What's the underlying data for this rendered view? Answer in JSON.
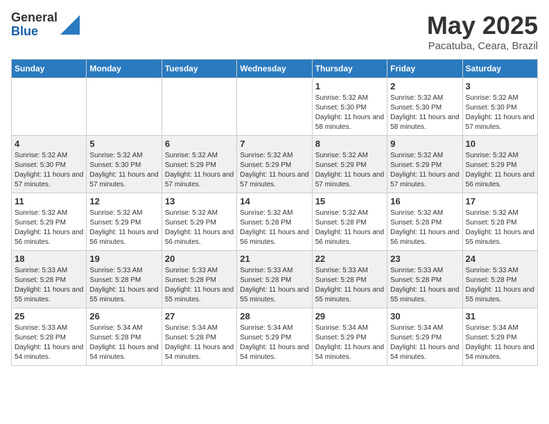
{
  "logo": {
    "general": "General",
    "blue": "Blue"
  },
  "title": "May 2025",
  "location": "Pacatuba, Ceara, Brazil",
  "weekdays": [
    "Sunday",
    "Monday",
    "Tuesday",
    "Wednesday",
    "Thursday",
    "Friday",
    "Saturday"
  ],
  "weeks": [
    [
      {
        "day": "",
        "info": ""
      },
      {
        "day": "",
        "info": ""
      },
      {
        "day": "",
        "info": ""
      },
      {
        "day": "",
        "info": ""
      },
      {
        "day": "1",
        "info": "Sunrise: 5:32 AM\nSunset: 5:30 PM\nDaylight: 11 hours and 58 minutes."
      },
      {
        "day": "2",
        "info": "Sunrise: 5:32 AM\nSunset: 5:30 PM\nDaylight: 11 hours and 58 minutes."
      },
      {
        "day": "3",
        "info": "Sunrise: 5:32 AM\nSunset: 5:30 PM\nDaylight: 11 hours and 57 minutes."
      }
    ],
    [
      {
        "day": "4",
        "info": "Sunrise: 5:32 AM\nSunset: 5:30 PM\nDaylight: 11 hours and 57 minutes."
      },
      {
        "day": "5",
        "info": "Sunrise: 5:32 AM\nSunset: 5:30 PM\nDaylight: 11 hours and 57 minutes."
      },
      {
        "day": "6",
        "info": "Sunrise: 5:32 AM\nSunset: 5:29 PM\nDaylight: 11 hours and 57 minutes."
      },
      {
        "day": "7",
        "info": "Sunrise: 5:32 AM\nSunset: 5:29 PM\nDaylight: 11 hours and 57 minutes."
      },
      {
        "day": "8",
        "info": "Sunrise: 5:32 AM\nSunset: 5:29 PM\nDaylight: 11 hours and 57 minutes."
      },
      {
        "day": "9",
        "info": "Sunrise: 5:32 AM\nSunset: 5:29 PM\nDaylight: 11 hours and 57 minutes."
      },
      {
        "day": "10",
        "info": "Sunrise: 5:32 AM\nSunset: 5:29 PM\nDaylight: 11 hours and 56 minutes."
      }
    ],
    [
      {
        "day": "11",
        "info": "Sunrise: 5:32 AM\nSunset: 5:29 PM\nDaylight: 11 hours and 56 minutes."
      },
      {
        "day": "12",
        "info": "Sunrise: 5:32 AM\nSunset: 5:29 PM\nDaylight: 11 hours and 56 minutes."
      },
      {
        "day": "13",
        "info": "Sunrise: 5:32 AM\nSunset: 5:29 PM\nDaylight: 11 hours and 56 minutes."
      },
      {
        "day": "14",
        "info": "Sunrise: 5:32 AM\nSunset: 5:28 PM\nDaylight: 11 hours and 56 minutes."
      },
      {
        "day": "15",
        "info": "Sunrise: 5:32 AM\nSunset: 5:28 PM\nDaylight: 11 hours and 56 minutes."
      },
      {
        "day": "16",
        "info": "Sunrise: 5:32 AM\nSunset: 5:28 PM\nDaylight: 11 hours and 56 minutes."
      },
      {
        "day": "17",
        "info": "Sunrise: 5:32 AM\nSunset: 5:28 PM\nDaylight: 11 hours and 55 minutes."
      }
    ],
    [
      {
        "day": "18",
        "info": "Sunrise: 5:33 AM\nSunset: 5:28 PM\nDaylight: 11 hours and 55 minutes."
      },
      {
        "day": "19",
        "info": "Sunrise: 5:33 AM\nSunset: 5:28 PM\nDaylight: 11 hours and 55 minutes."
      },
      {
        "day": "20",
        "info": "Sunrise: 5:33 AM\nSunset: 5:28 PM\nDaylight: 11 hours and 55 minutes."
      },
      {
        "day": "21",
        "info": "Sunrise: 5:33 AM\nSunset: 5:28 PM\nDaylight: 11 hours and 55 minutes."
      },
      {
        "day": "22",
        "info": "Sunrise: 5:33 AM\nSunset: 5:28 PM\nDaylight: 11 hours and 55 minutes."
      },
      {
        "day": "23",
        "info": "Sunrise: 5:33 AM\nSunset: 5:28 PM\nDaylight: 11 hours and 55 minutes."
      },
      {
        "day": "24",
        "info": "Sunrise: 5:33 AM\nSunset: 5:28 PM\nDaylight: 11 hours and 55 minutes."
      }
    ],
    [
      {
        "day": "25",
        "info": "Sunrise: 5:33 AM\nSunset: 5:28 PM\nDaylight: 11 hours and 54 minutes."
      },
      {
        "day": "26",
        "info": "Sunrise: 5:34 AM\nSunset: 5:28 PM\nDaylight: 11 hours and 54 minutes."
      },
      {
        "day": "27",
        "info": "Sunrise: 5:34 AM\nSunset: 5:28 PM\nDaylight: 11 hours and 54 minutes."
      },
      {
        "day": "28",
        "info": "Sunrise: 5:34 AM\nSunset: 5:29 PM\nDaylight: 11 hours and 54 minutes."
      },
      {
        "day": "29",
        "info": "Sunrise: 5:34 AM\nSunset: 5:29 PM\nDaylight: 11 hours and 54 minutes."
      },
      {
        "day": "30",
        "info": "Sunrise: 5:34 AM\nSunset: 5:29 PM\nDaylight: 11 hours and 54 minutes."
      },
      {
        "day": "31",
        "info": "Sunrise: 5:34 AM\nSunset: 5:29 PM\nDaylight: 11 hours and 54 minutes."
      }
    ]
  ]
}
